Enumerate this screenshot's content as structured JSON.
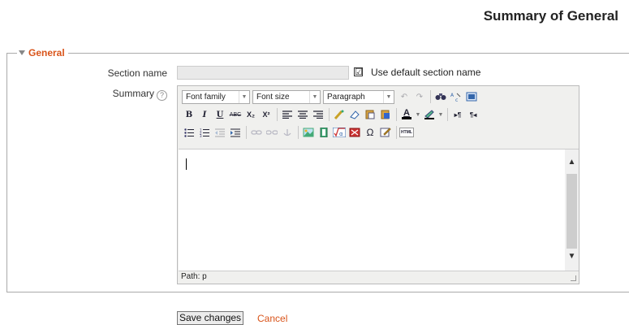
{
  "page_title": "Summary of General",
  "fieldset": {
    "legend": "General"
  },
  "section_name": {
    "label": "Section name",
    "value": ""
  },
  "use_default": {
    "label": "Use default section name",
    "checked": true,
    "mark": "☑"
  },
  "summary": {
    "label": "Summary",
    "help_icon": "?"
  },
  "editor": {
    "font_family": "Font family",
    "font_size": "Font size",
    "format": "Paragraph",
    "toolbar_row1_icons": [
      "undo-icon",
      "redo-icon",
      "find-icon",
      "replace-icon",
      "fullscreen-icon"
    ],
    "toolbar_row2": [
      "B",
      "I",
      "U",
      "ABC",
      "X₂",
      "X²"
    ],
    "toolbar_row3_icons": [
      "bullet-list-icon",
      "numbered-list-icon",
      "outdent-icon",
      "indent-icon",
      "link-icon",
      "unlink-icon",
      "anchor-icon",
      "image-icon",
      "media-icon",
      "equation-icon",
      "spellcheck-icon",
      "special-char-icon",
      "paste-word-icon"
    ],
    "html_label": "HTML",
    "path": "Path: p"
  },
  "buttons": {
    "save": "Save changes",
    "cancel": "Cancel"
  },
  "colors": {
    "accent": "#d9541a"
  }
}
